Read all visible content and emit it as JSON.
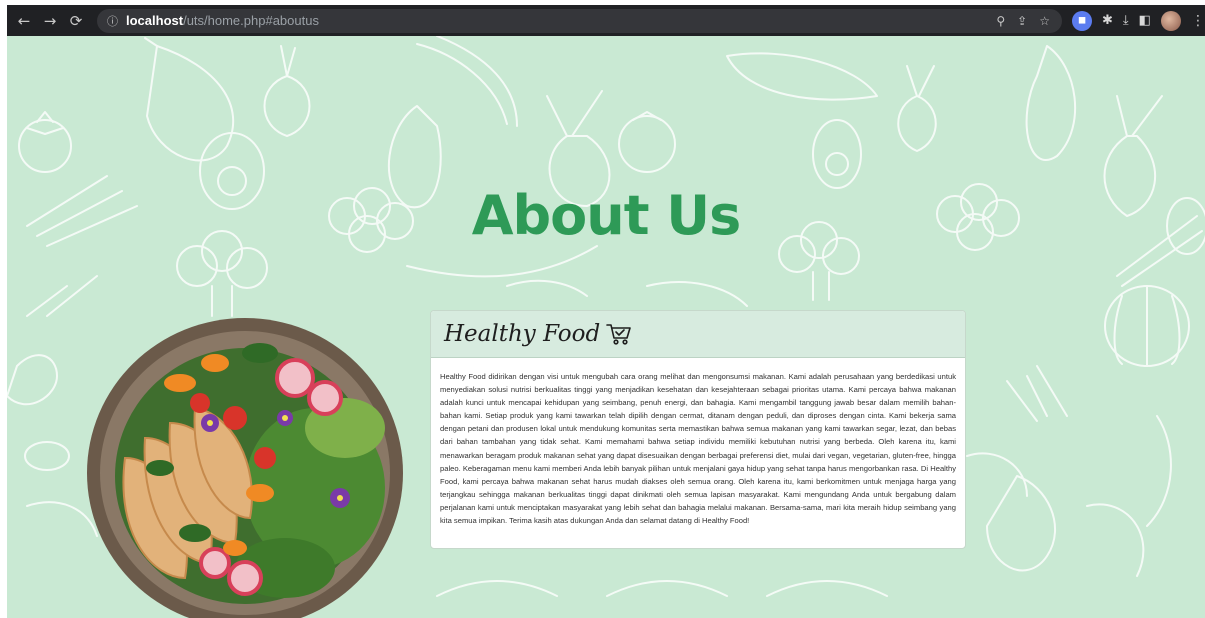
{
  "browser": {
    "url_host": "localhost",
    "url_path": "/uts/home.php#aboutus",
    "icons": [
      "back-icon",
      "forward-icon",
      "reload-icon",
      "info-icon",
      "zoom-icon",
      "share-icon",
      "star-icon",
      "extension-icon",
      "puzzle-icon",
      "download-icon",
      "sidepanel-icon",
      "avatar",
      "menu-icon"
    ]
  },
  "page": {
    "heading": "About Us",
    "background_color": "#c9e9d3",
    "accent_color": "#2e9a57"
  },
  "card": {
    "title": "Healthy Food",
    "title_icon": "cart-icon",
    "body": "Healthy Food didirikan dengan visi untuk mengubah cara orang melihat dan mengonsumsi makanan. Kami adalah perusahaan yang berdedikasi untuk menyediakan solusi nutrisi berkualitas tinggi yang menjadikan kesehatan dan kesejahteraan sebagai prioritas utama. Kami percaya bahwa makanan adalah kunci untuk mencapai kehidupan yang seimbang, penuh energi, dan bahagia. Kami mengambil tanggung jawab besar dalam memilih bahan-bahan kami. Setiap produk yang kami tawarkan telah dipilih dengan cermat, ditanam dengan peduli, dan diproses dengan cinta. Kami bekerja sama dengan petani dan produsen lokal untuk mendukung komunitas serta memastikan bahwa semua makanan yang kami tawarkan segar, lezat, dan bebas dari bahan tambahan yang tidak sehat. Kami memahami bahwa setiap individu memiliki kebutuhan nutrisi yang berbeda. Oleh karena itu, kami menawarkan beragam produk makanan sehat yang dapat disesuaikan dengan berbagai preferensi diet, mulai dari vegan, vegetarian, gluten-free, hingga paleo. Keberagaman menu kami memberi Anda lebih banyak pilihan untuk menjalani gaya hidup yang sehat tanpa harus mengorbankan rasa. Di Healthy Food, kami percaya bahwa makanan sehat harus mudah diakses oleh semua orang. Oleh karena itu, kami berkomitmen untuk menjaga harga yang terjangkau sehingga makanan berkualitas tinggi dapat dinikmati oleh semua lapisan masyarakat. Kami mengundang Anda untuk bergabung dalam perjalanan kami untuk menciptakan masyarakat yang lebih sehat dan bahagia melalui makanan. Bersama-sama, mari kita meraih hidup seimbang yang kita semua impikan. Terima kasih atas dukungan Anda dan selamat datang di Healthy Food!"
  },
  "image": {
    "subject": "salad-bowl"
  }
}
